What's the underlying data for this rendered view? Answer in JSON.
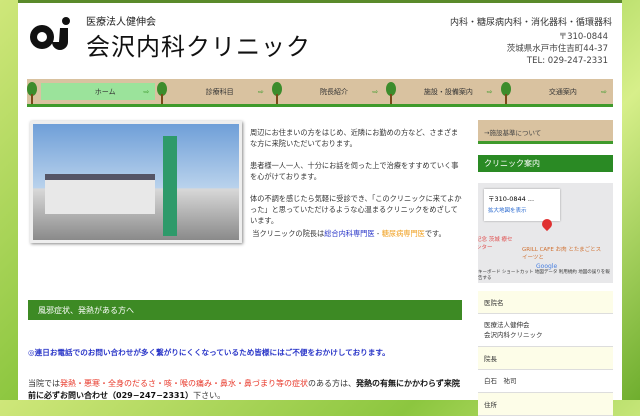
{
  "header": {
    "org": "医療法人健伸会",
    "clinic_name": "会沢内科クリニック",
    "logo_text": "ai",
    "departments": "内科・糖尿病内科・消化器科・循環器科",
    "postal": "〒310-0844",
    "address": "茨城県水戸市住吉町44-37",
    "tel": "TEL: 029-247-2331"
  },
  "nav": {
    "items": [
      {
        "label": "ホーム"
      },
      {
        "label": "診療科目"
      },
      {
        "label": "院長紹介"
      },
      {
        "label": "施設・設備案内"
      },
      {
        "label": "交通案内"
      }
    ],
    "arrow": "⇨"
  },
  "intro": {
    "p1": "周辺にお住まいの方をはじめ、近隣にお勤めの方など、さまざまな方に来院いただいております。",
    "p2": "患者様一人一人、十分にお話を伺った上で治療をすすめていく事を心がけております。",
    "p3": "体の不調を感じたら気軽に受診でき、「このクリニックに来てよかった」と思っていただけるような心温まるクリニックをめざしています。",
    "p4_pre": "当クリニックの院長は",
    "link1": "総合内科専門医",
    "sep": " - ",
    "link2": "糖尿病専門医",
    "p4_post": "です。"
  },
  "section": {
    "title": "風邪症状、発熱がある方へ",
    "notice": "◎連日お電話でのお問い合わせが多く繋がりにくくなっているため皆様にはご不便をおかけしております。",
    "body_pre": "当院では",
    "symptoms": "発熱・悪寒・全身のだるさ・咳・喉の痛み・鼻水・鼻づまり等の症状",
    "body_mid": "のある方は、",
    "bold": "発熱の有無にかかわらず来院前に必ずお問い合わせ（029−247−2331）",
    "body_post": "下さい。"
  },
  "sidebar": {
    "button": "→施設基準について",
    "heading": "クリニック案内",
    "map": {
      "popup_title": "〒310-0844 ...",
      "popup_link": "拡大地図を表示",
      "label1": "GRILL CAFE お肉 とたまごとスイーツと",
      "label2": "記念 茨城 療センター",
      "google": "Google",
      "footer": "キーボード ショートカット  地図データ  利用規約  地図の誤りを報告する"
    },
    "info": [
      {
        "h": "医院名",
        "v": "医療法人健伸会\n会沢内科クリニック"
      },
      {
        "h": "院長",
        "v": "白石　祐司"
      },
      {
        "h": "住所",
        "v": ""
      }
    ]
  },
  "colors": {
    "green": "#3d8a24",
    "tan": "#d9c2a0",
    "blue_link": "#2a36c8",
    "orange_link": "#f0a020",
    "red": "#e8382a"
  }
}
